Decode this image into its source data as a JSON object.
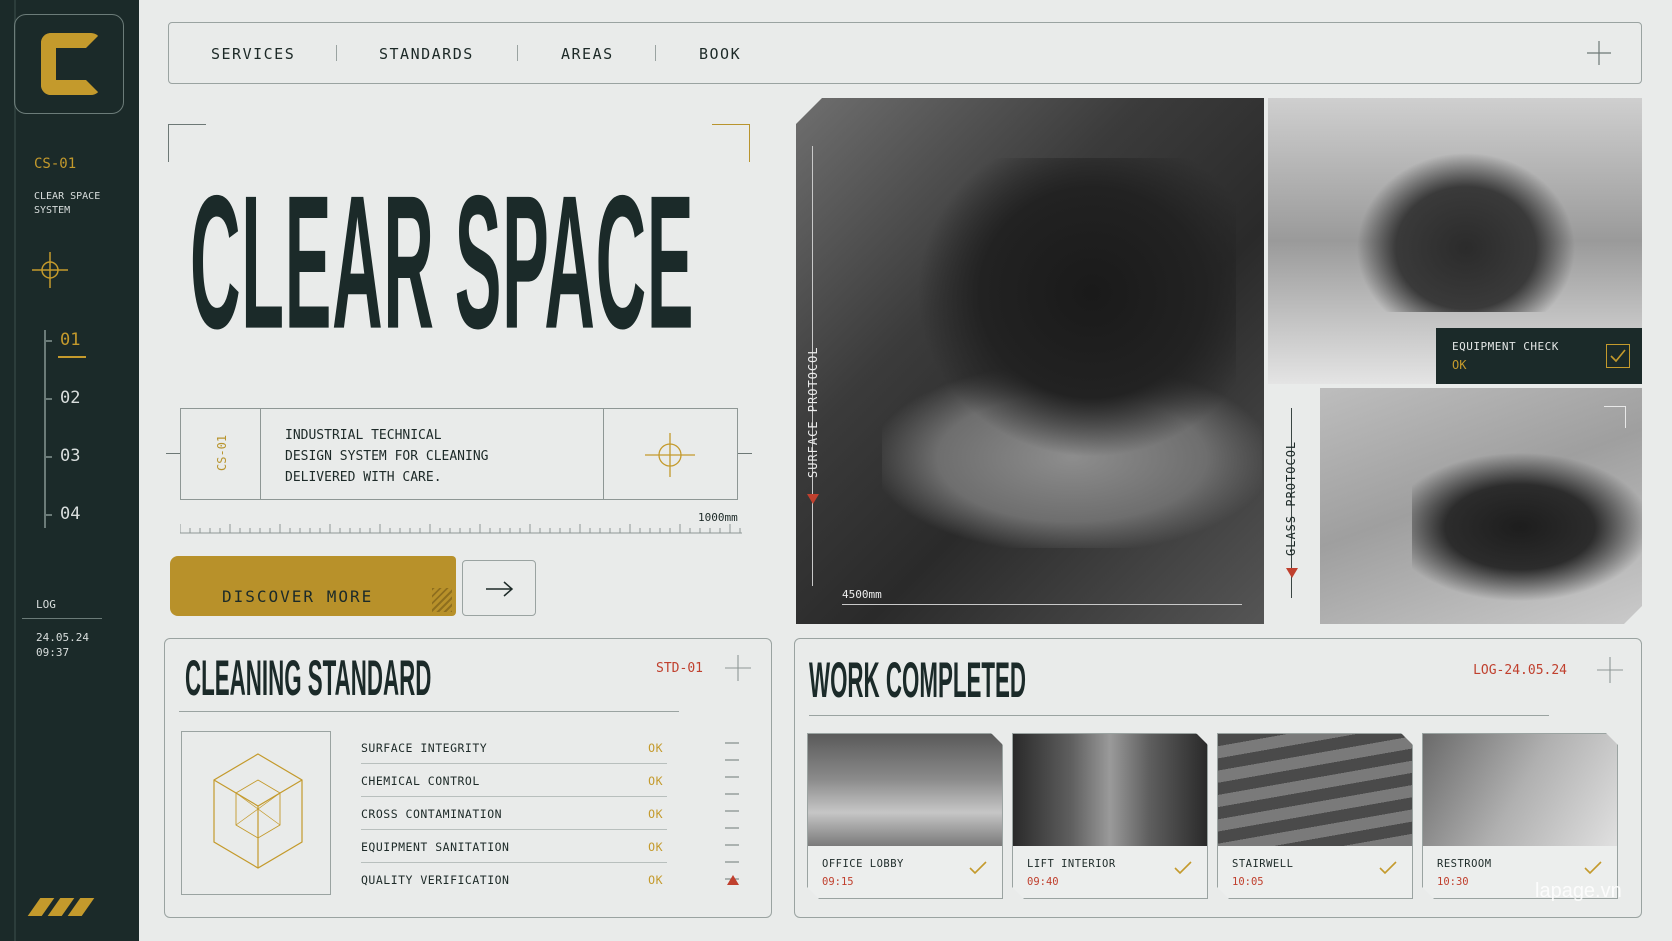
{
  "sidebar": {
    "code": "CS-01",
    "system_name": "CLEAR SPACE SYSTEM",
    "steps": [
      "01",
      "02",
      "03",
      "04"
    ],
    "active_step": "01",
    "log_label": "LOG",
    "log_date": "24.05.24",
    "log_time": "09:37"
  },
  "nav": {
    "items": [
      "SERVICES",
      "STANDARDS",
      "AREAS",
      "BOOK"
    ]
  },
  "hero": {
    "title": "CLEAR SPACE",
    "code": "CS-01",
    "description": "INDUSTRIAL TECHNICAL\nDESIGN SYSTEM FOR CLEANING\nDELIVERED WITH CARE.",
    "ruler_label": "1000mm",
    "cta_label": "DISCOVER MORE"
  },
  "photos": {
    "main_label": "SURFACE PROTOCOL",
    "main_measure": "4500mm",
    "equipment_title": "EQUIPMENT CHECK",
    "equipment_status": "OK",
    "glass_label": "GLASS PROTOCOL"
  },
  "standard": {
    "title": "CLEANING STANDARD",
    "code": "STD-01",
    "rows": [
      {
        "label": "SURFACE INTEGRITY",
        "status": "OK"
      },
      {
        "label": "CHEMICAL CONTROL",
        "status": "OK"
      },
      {
        "label": "CROSS CONTAMINATION",
        "status": "OK"
      },
      {
        "label": "EQUIPMENT SANITATION",
        "status": "OK"
      },
      {
        "label": "QUALITY VERIFICATION",
        "status": "OK"
      }
    ]
  },
  "work": {
    "title": "WORK COMPLETED",
    "code": "LOG-24.05.24",
    "cards": [
      {
        "name": "OFFICE LOBBY",
        "time": "09:15",
        "img": "lobby"
      },
      {
        "name": "LIFT INTERIOR",
        "time": "09:40",
        "img": "lift"
      },
      {
        "name": "STAIRWELL",
        "time": "10:05",
        "img": "stair"
      },
      {
        "name": "RESTROOM",
        "time": "10:30",
        "img": "rest"
      }
    ]
  },
  "watermark": "lapage.vn",
  "colors": {
    "accent": "#c49a2c",
    "dark": "#1b2a29",
    "alert": "#c0402e",
    "background": "#e9ebea"
  }
}
